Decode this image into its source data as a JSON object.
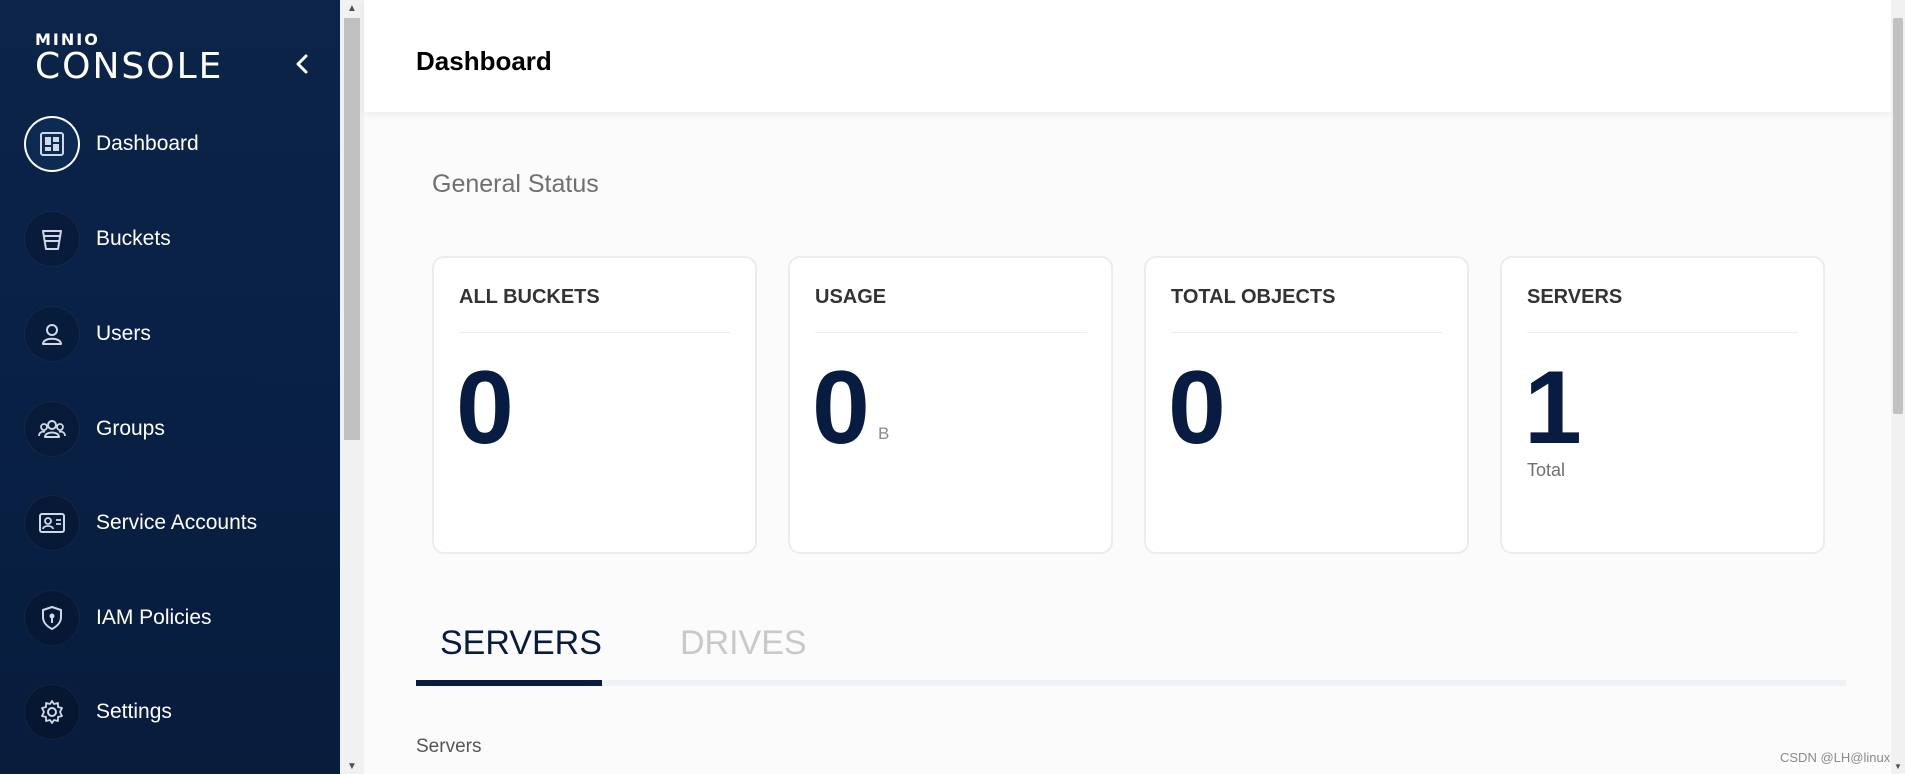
{
  "brand": {
    "small": "MINIO",
    "large": "CONSOLE"
  },
  "sidebar": {
    "items": [
      {
        "label": "Dashboard",
        "icon": "dashboard-icon",
        "active": true
      },
      {
        "label": "Buckets",
        "icon": "bucket-icon"
      },
      {
        "label": "Users",
        "icon": "user-icon"
      },
      {
        "label": "Groups",
        "icon": "groups-icon"
      },
      {
        "label": "Service Accounts",
        "icon": "id-card-icon"
      },
      {
        "label": "IAM Policies",
        "icon": "shield-icon"
      },
      {
        "label": "Settings",
        "icon": "gear-icon"
      }
    ]
  },
  "header": {
    "title": "Dashboard"
  },
  "main": {
    "section_title": "General Status",
    "cards": [
      {
        "title": "ALL BUCKETS",
        "value": "0"
      },
      {
        "title": "USAGE",
        "value": "0",
        "unit": "B"
      },
      {
        "title": "TOTAL OBJECTS",
        "value": "0"
      },
      {
        "title": "SERVERS",
        "value": "1",
        "sub": "Total"
      }
    ],
    "tabs": [
      {
        "label": "SERVERS",
        "active": true
      },
      {
        "label": "DRIVES",
        "active": false
      }
    ],
    "servers_label": "Servers"
  },
  "watermark": "CSDN @LH@linux",
  "colors": {
    "sidebar_bg": "#0b2447",
    "accent": "#081c42",
    "card_border": "#eaedee"
  }
}
